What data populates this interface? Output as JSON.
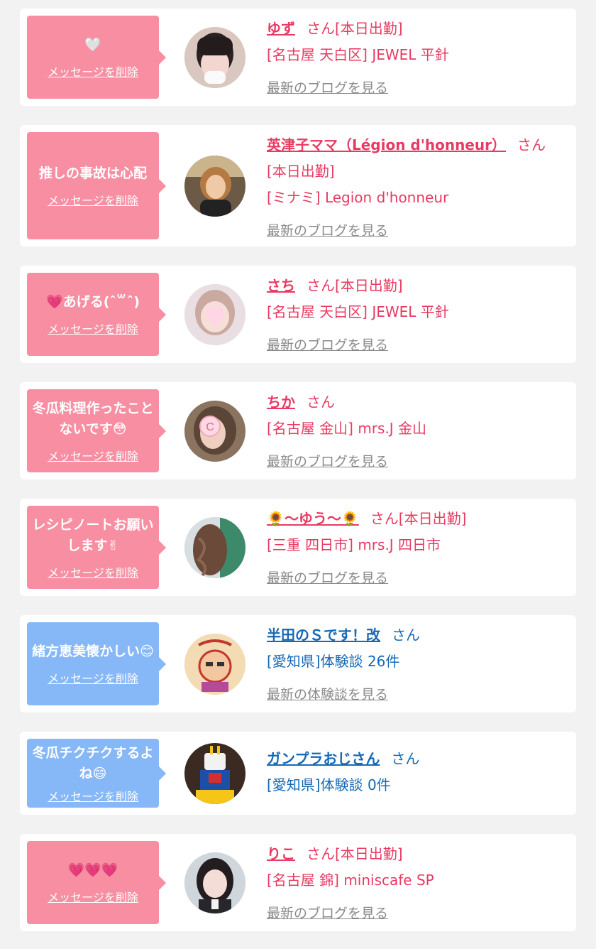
{
  "delete_label": "メッセージを削除",
  "colors": {
    "pink_bubble": "#f78ea2",
    "blue_bubble": "#86b7f6",
    "pink_text": "#e83a62",
    "blue_text": "#1669b4",
    "blog_link": "#8a8a8a"
  },
  "cards": [
    {
      "msg": "🤍",
      "name": "ゆず",
      "suffix": "さん[本日出勤]",
      "shop": "[名古屋 天白区] JEWEL 平針",
      "link": "最新のブログを見る"
    },
    {
      "msg": "推しの事故は心配",
      "name": "英津子ママ（Légion d'honneur）",
      "suffix": "さん[本日出勤]",
      "shop": "[ミナミ] Legion d'honneur",
      "link": "最新のブログを見る"
    },
    {
      "msg": "💗あげる(ˆ꒳ˆ)",
      "name": "さち",
      "suffix": "さん[本日出勤]",
      "shop": "[名古屋 天白区] JEWEL 平針",
      "link": "最新のブログを見る"
    },
    {
      "msg": "冬瓜料理作ったことないです😳",
      "name": "ちか",
      "suffix": "さん",
      "shop": "[名古屋 金山] mrs.J 金山",
      "link": "最新のブログを見る"
    },
    {
      "msg": "レシピノートお願いします✌",
      "name": "🌻～ゆう～🌻",
      "suffix": "さん[本日出勤]",
      "shop": "[三重 四日市] mrs.J 四日市",
      "link": "最新のブログを見る"
    },
    {
      "msg": "緒方恵美懐かしい😊",
      "name": "半田のＳです！改",
      "suffix": "さん",
      "shop": "[愛知県]体験談 26件",
      "link": "最新の体験談を見る"
    },
    {
      "msg": "冬瓜チクチクするよね😄",
      "name": "ガンプラおじさん",
      "suffix": "さん",
      "shop": "[愛知県]体験談 0件",
      "link": ""
    },
    {
      "msg": "💗💗💗",
      "name": "りこ",
      "suffix": "さん[本日出勤]",
      "shop": "[名古屋 錦] miniscafe SP",
      "link": "最新のブログを見る"
    }
  ]
}
